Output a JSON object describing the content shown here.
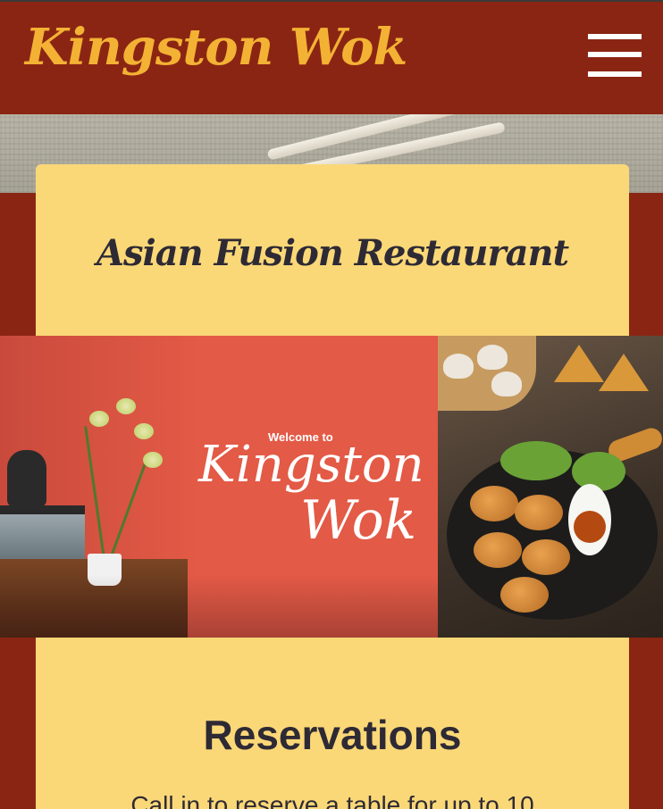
{
  "header": {
    "brand": "Kingston Wok",
    "menu_icon": "hamburger-menu-icon"
  },
  "hero": {
    "tagline": "Asian Fusion Restaurant"
  },
  "banner": {
    "welcome_small": "Welcome to",
    "welcome_line1": "Kingston",
    "welcome_line2": "Wok"
  },
  "reservations": {
    "title": "Reservations",
    "text": "Call in to reserve a table for up to 10"
  },
  "colors": {
    "header_bg": "#8b2513",
    "brand": "#f3b234",
    "card_bg": "#fbd877",
    "text_dark": "#2e2a35",
    "banner_red": "#e35a46"
  }
}
